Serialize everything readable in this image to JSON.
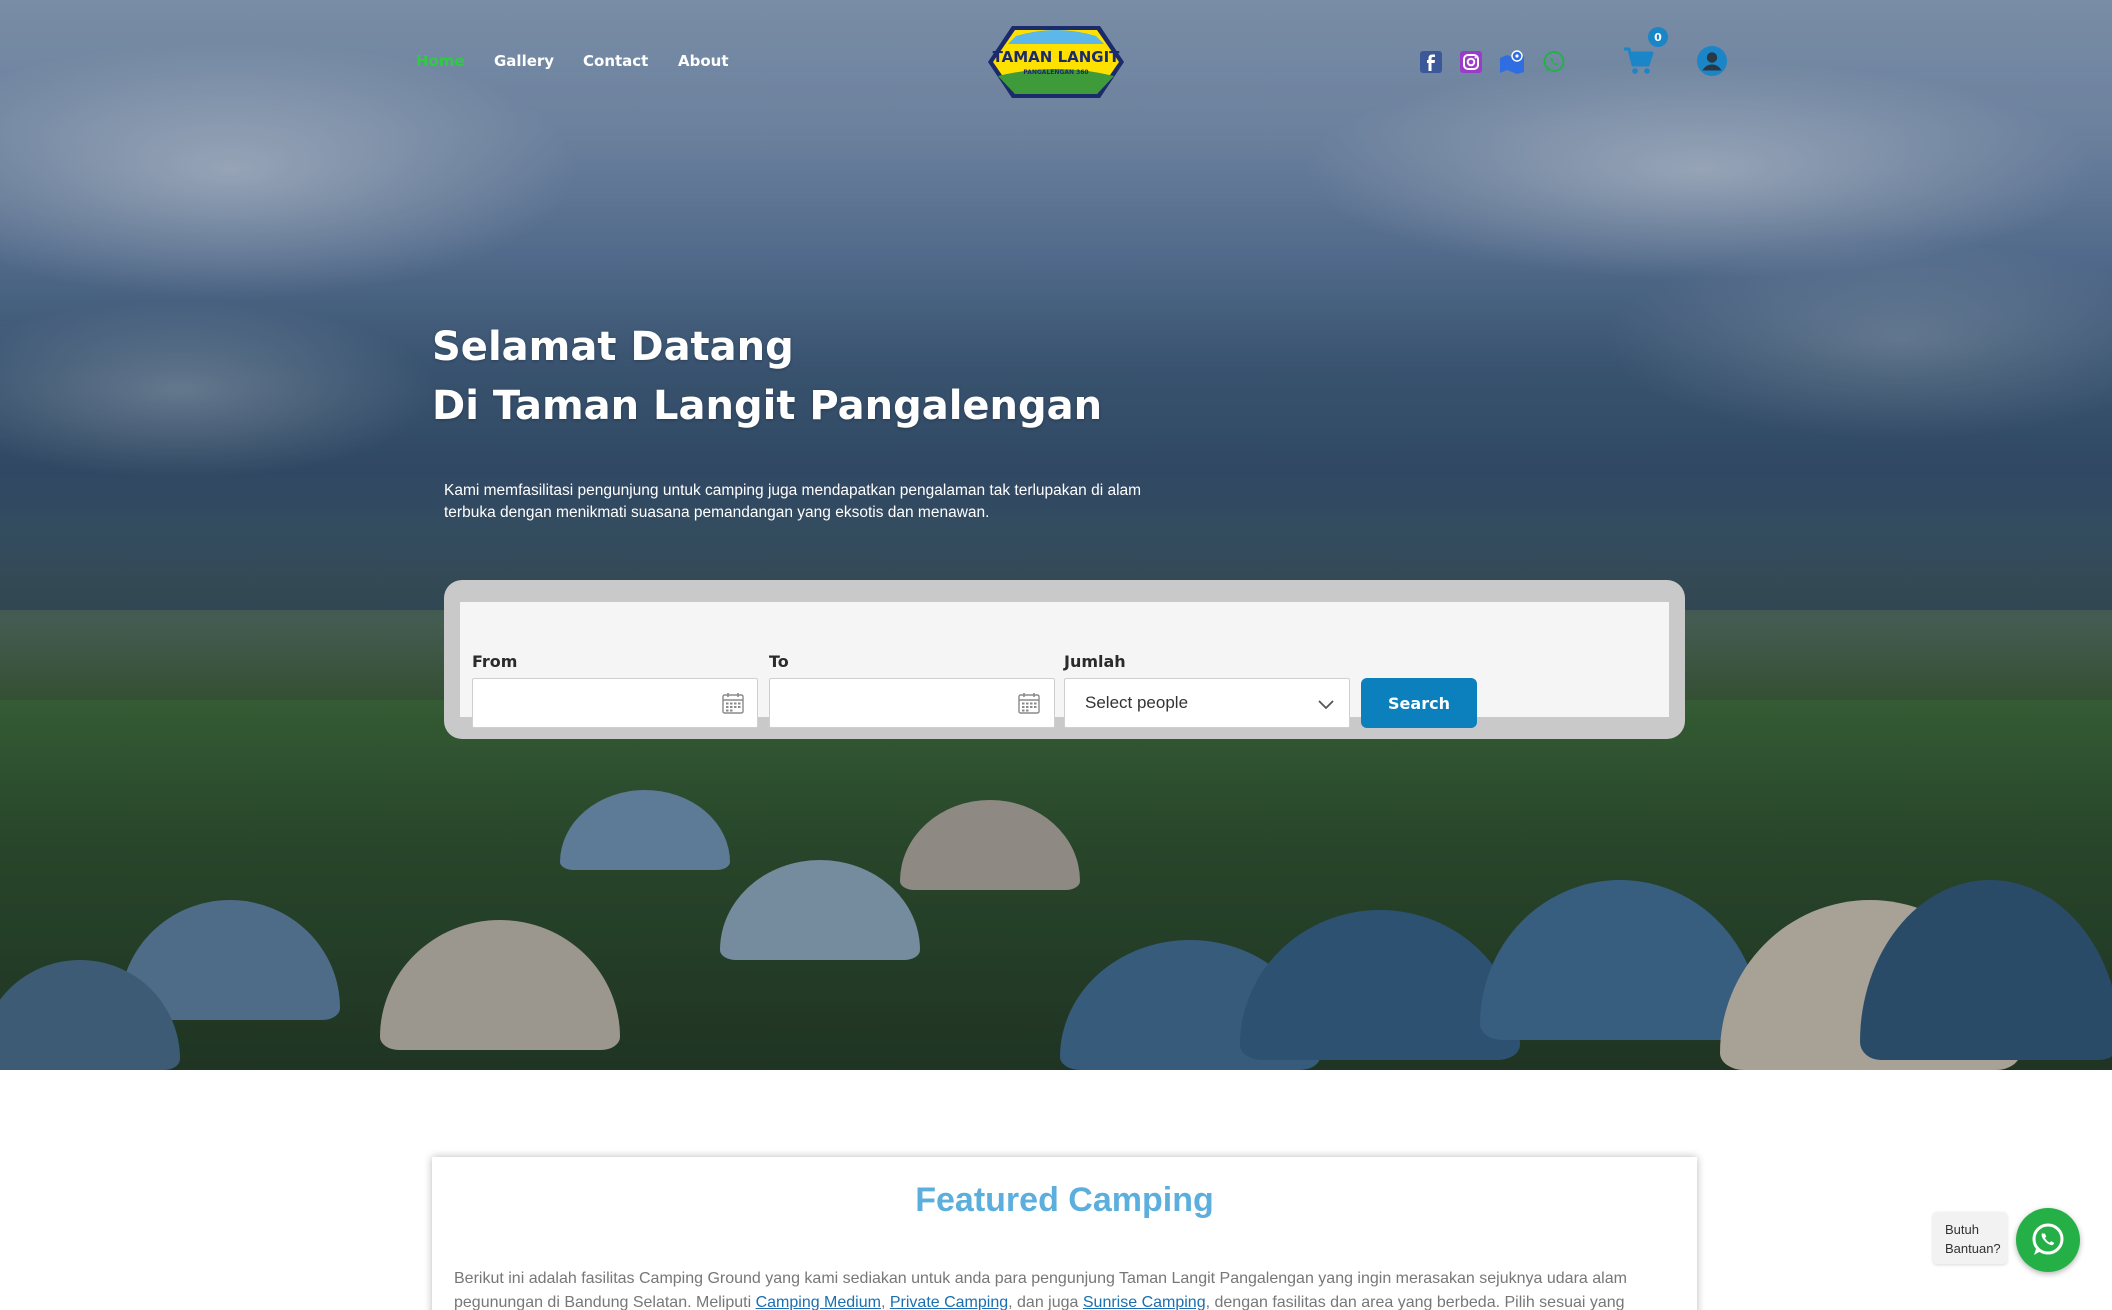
{
  "nav": {
    "items": [
      {
        "label": "Home",
        "active": true
      },
      {
        "label": "Gallery",
        "active": false
      },
      {
        "label": "Contact",
        "active": false
      },
      {
        "label": "About",
        "active": false
      }
    ],
    "active_color": "#2ecc40"
  },
  "logo": {
    "line1": "TAMAN LANGIT",
    "line2": "PANGALENGAN 360"
  },
  "social": [
    {
      "icon": "facebook-icon",
      "color": "#3b5998"
    },
    {
      "icon": "instagram-icon",
      "color": "#9b3cc9"
    },
    {
      "icon": "maps-icon",
      "color": "#2f6ee0"
    },
    {
      "icon": "whatsapp-icon",
      "color": "#25b047"
    }
  ],
  "cart": {
    "icon": "cart-icon",
    "count": "0",
    "color": "#1a85c7"
  },
  "user": {
    "icon": "user-icon",
    "color": "#1a85c7"
  },
  "hero": {
    "title_line1": "Selamat Datang",
    "title_line2": "Di Taman Langit Pangalengan",
    "description": "Kami memfasilitasi pengunjung untuk camping juga mendapatkan pengalaman tak terlupakan di alam terbuka dengan menikmati suasana pemandangan yang eksotis dan menawan."
  },
  "search": {
    "from_label": "From",
    "from_value": "",
    "to_label": "To",
    "to_value": "",
    "jumlah_label": "Jumlah",
    "jumlah_selected": "Select people",
    "button_label": "Search",
    "button_color": "#0b80bd"
  },
  "featured": {
    "title": "Featured Camping",
    "title_color": "#5cafdc",
    "text_1": "Berikut ini adalah  fasilitas Camping Ground yang kami sediakan untuk anda para pengunjung Taman Langit Pangalengan yang ingin merasakan sejuknya udara alam pegunungan di Bandung Selatan. Meliputi ",
    "link_1": "Camping Medium",
    "sep_1": ", ",
    "link_2": "Private Camping",
    "sep_2": ", dan juga ",
    "link_3": "Sunrise Camping",
    "text_2": ", dengan fasilitas dan area yang berbeda. Pilih sesuai yang"
  },
  "help": {
    "line1": "Butuh",
    "line2": "Bantuan?",
    "icon": "whatsapp-icon",
    "color": "#25b047"
  }
}
